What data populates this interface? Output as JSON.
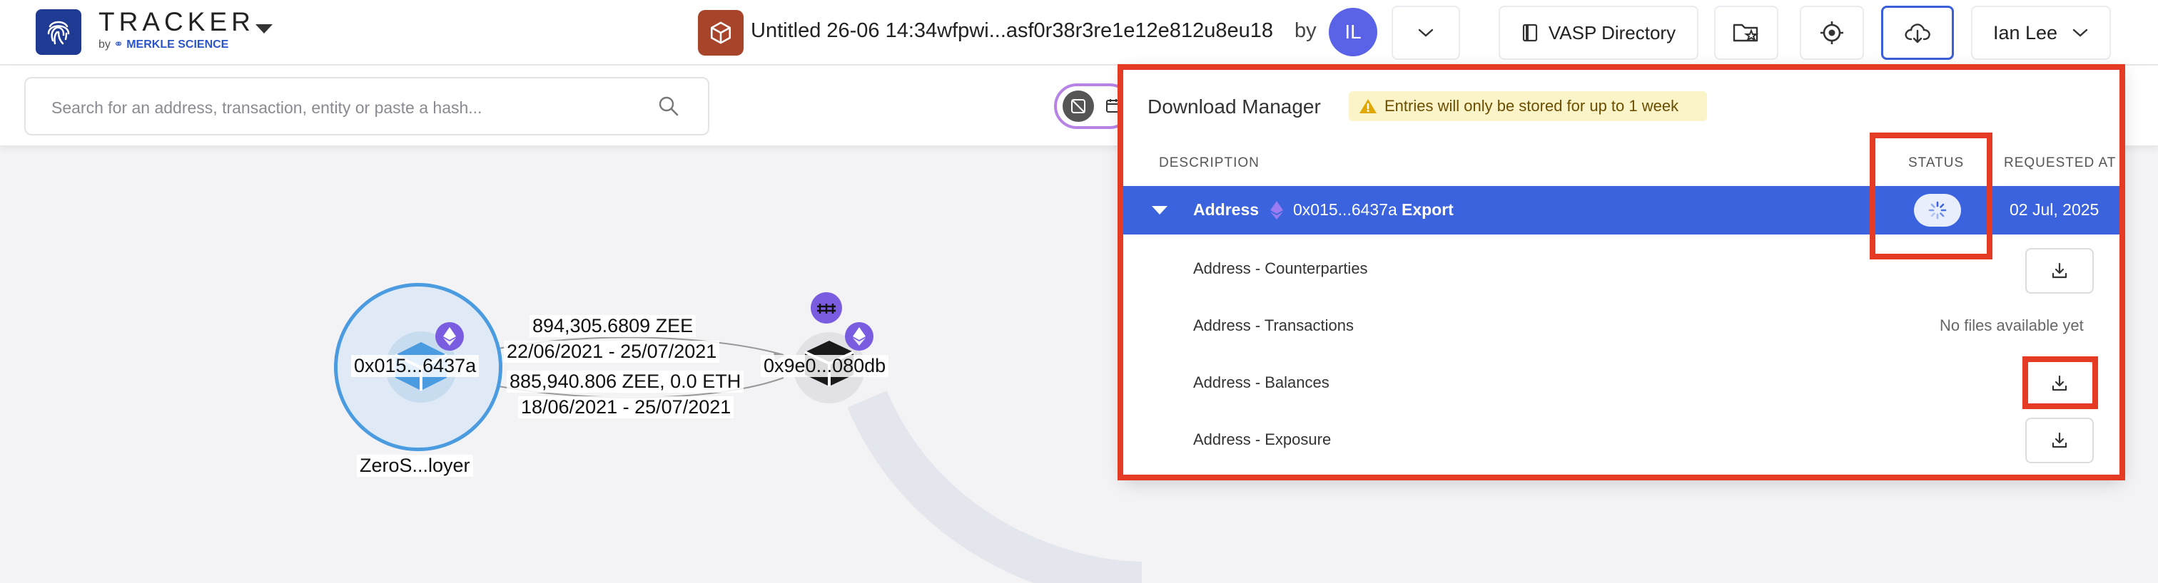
{
  "header": {
    "brand": "TRACKER",
    "brand_by": "by",
    "brand_company": "MERKLE SCIENCE",
    "project_title": "Untitled 26-06 14:34wfpwi...asf0r38r3re1e12e812u8eu18",
    "by_label": "by",
    "avatar_initials": "IL",
    "vasp_label": "VASP Directory",
    "user_name": "Ian Lee"
  },
  "search": {
    "placeholder": "Search for an address, transaction, entity or paste a hash..."
  },
  "graph": {
    "node_a_label": "0x015...6437a",
    "node_a_name": "ZeroS...loyer",
    "node_b_label": "0x9e0...080db",
    "edge_top_amount": "894,305.6809 ZEE",
    "edge_top_dates": "22/06/2021 - 25/07/2021",
    "edge_bottom_amount": "885,940.806 ZEE, 0.0 ETH",
    "edge_bottom_dates": "18/06/2021 - 25/07/2021"
  },
  "download_manager": {
    "title": "Download Manager",
    "warning": "Entries will only be stored for up to 1 week",
    "columns": {
      "description": "DESCRIPTION",
      "status": "STATUS",
      "requested_at": "REQUESTED AT"
    },
    "selected_row": {
      "type": "Address",
      "address": "0x015...6437a",
      "action": "Export",
      "date": "02 Jul, 2025"
    },
    "sub_rows": [
      {
        "label": "Address - Counterparties",
        "status": "download"
      },
      {
        "label": "Address - Transactions",
        "status": "No files available yet"
      },
      {
        "label": "Address - Balances",
        "status": "download"
      },
      {
        "label": "Address - Exposure",
        "status": "download"
      }
    ]
  },
  "colors": {
    "brand_blue": "#1f3a93",
    "selected_row": "#3a63dd",
    "highlight_red": "#e53a24",
    "eth_purple": "#7a5ce0"
  }
}
